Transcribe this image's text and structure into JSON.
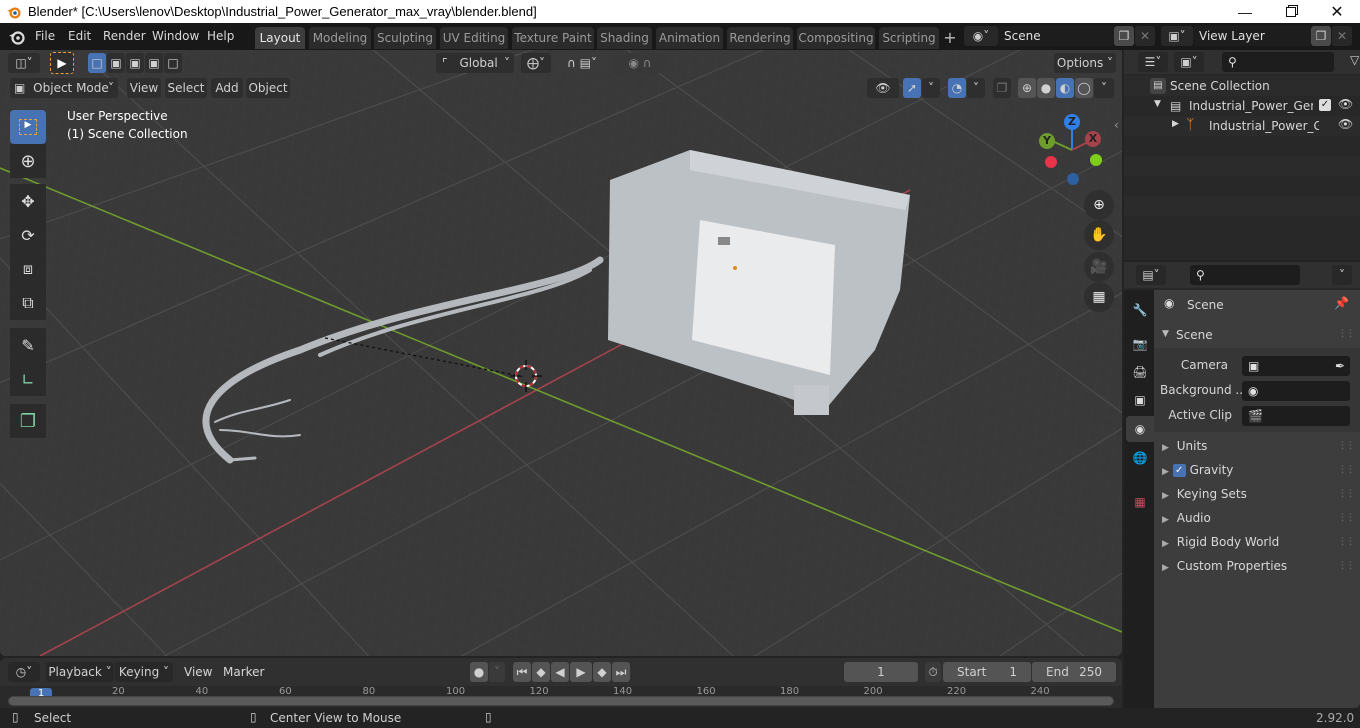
{
  "window": {
    "title": "Blender* [C:\\Users\\lenov\\Desktop\\Industrial_Power_Generator_max_vray\\blender.blend]",
    "minimize_icon": "minimize-icon",
    "maximize_icon": "restore-icon",
    "close_icon": "close-icon"
  },
  "menu": {
    "items": [
      "File",
      "Edit",
      "Render",
      "Window",
      "Help"
    ]
  },
  "workspaces": {
    "tabs": [
      "Layout",
      "Modeling",
      "Sculpting",
      "UV Editing",
      "Texture Paint",
      "Shading",
      "Animation",
      "Rendering",
      "Compositing",
      "Scripting"
    ],
    "active": "Layout",
    "add_label": "+"
  },
  "scene_selector": {
    "value": "Scene"
  },
  "view_layer_selector": {
    "value": "View Layer"
  },
  "viewport_header": {
    "transform_orientation": "Global",
    "options_label": "Options",
    "mode": "Object Mode",
    "menus": [
      "View",
      "Select",
      "Add",
      "Object"
    ]
  },
  "viewport": {
    "overlay_line1": "User Perspective",
    "overlay_line2": "(1) Scene Collection",
    "axis_labels": {
      "x": "X",
      "y": "Y",
      "z": "Z"
    },
    "colors": {
      "x_axis": "#a5434d",
      "y_axis": "#6e9c2d",
      "z_axis": "#2f80e8",
      "background": "#393939"
    }
  },
  "tools": [
    "select-box",
    "cursor",
    "move",
    "rotate",
    "scale",
    "transform",
    "annotate",
    "measure",
    "add-cube"
  ],
  "outliner": {
    "root": "Scene Collection",
    "items": [
      {
        "label": "Industrial_Power_Genera",
        "expanded": true,
        "checked": true,
        "visible": true
      },
      {
        "label": "Industrial_Power_Ge",
        "expanded": false,
        "visible": true
      }
    ]
  },
  "properties": {
    "context_title": "Scene",
    "panel_title": "Scene",
    "fields": [
      {
        "label": "Camera",
        "value": ""
      },
      {
        "label": "Background ...",
        "value": ""
      },
      {
        "label": "Active Clip",
        "value": ""
      }
    ],
    "sections": [
      {
        "label": "Units"
      },
      {
        "label": "Gravity",
        "checkbox": true
      },
      {
        "label": "Keying Sets"
      },
      {
        "label": "Audio"
      },
      {
        "label": "Rigid Body World"
      },
      {
        "label": "Custom Properties"
      }
    ]
  },
  "timeline": {
    "menus": [
      "Playback",
      "Keying",
      "View",
      "Marker"
    ],
    "current_frame": "1",
    "start_label": "Start",
    "start_value": "1",
    "end_label": "End",
    "end_value": "250",
    "ruler": [
      "20",
      "40",
      "60",
      "80",
      "100",
      "120",
      "140",
      "160",
      "180",
      "200",
      "220",
      "240"
    ],
    "playhead": "1"
  },
  "status": {
    "left": "Select",
    "middle": "Center View to Mouse",
    "version": "2.92.0"
  },
  "accent_color": "#4772b3"
}
